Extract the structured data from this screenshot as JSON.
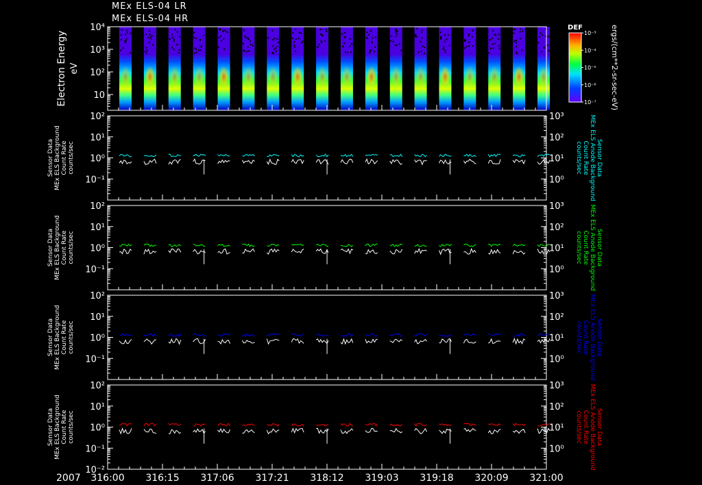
{
  "header": {
    "line1": "MEx ELS-04 LR",
    "line2": "MEx ELS-04 HR"
  },
  "time_axis": {
    "year": "2007",
    "ticks": [
      "316:00",
      "316:15",
      "317:06",
      "317:21",
      "318:12",
      "319:03",
      "319:18",
      "320:09",
      "321:00"
    ]
  },
  "colors": {
    "background": "#000000",
    "axes": "#ffffff",
    "trace_primary": "#ffffff",
    "cyan": "#00ffff",
    "green": "#00ff00",
    "blue": "#0000ff",
    "red": "#ff0000"
  },
  "chart_data": [
    {
      "type": "heatmap",
      "ylabel": "Electron Energy",
      "ylabel_unit": "eV",
      "y_scale": "log",
      "ylim": [
        2,
        10000
      ],
      "ytick_labels": [
        "10",
        "10²",
        "10³",
        "10⁴"
      ],
      "colorbar": {
        "title": "DEF",
        "label": "ergs/(cm**2-sr-sec-eV)",
        "scale": "log",
        "range": [
          1e-07,
          0.001
        ],
        "tick_labels": [
          "10⁻³",
          "10⁻⁴",
          "10⁻⁵",
          "10⁻⁶",
          "10⁻⁷"
        ]
      },
      "passes": 18
    },
    {
      "type": "line",
      "left_label": [
        "Sensor Data",
        "MEx ELS Background",
        "Count Rate",
        "counts/sec"
      ],
      "right_label": [
        "Sensor Data",
        "MEx ELS Anode Background",
        "Count Rate",
        "counts/sec"
      ],
      "right_color": "#00ffff",
      "y_scale": "log",
      "ylim_left": [
        0.01,
        100
      ],
      "ylim_right": [
        0.1,
        1000
      ],
      "left_tick_labels": [
        "10²",
        "10¹",
        "10⁰",
        "10⁻¹",
        ""
      ],
      "right_tick_labels": [
        "10³",
        "10²",
        "10¹",
        "10⁰",
        ""
      ],
      "series": [
        {
          "name": "Background",
          "color": "#ffffff",
          "typical": 0.85
        },
        {
          "name": "Anode Background",
          "color": "#00ffff",
          "typical": 13
        }
      ]
    },
    {
      "type": "line",
      "left_label": [
        "Sensor Data",
        "MEx ELS Background",
        "Count Rate",
        "counts/sec"
      ],
      "right_label": [
        "Sensor Data",
        "MEx ELS Anode Background",
        "Count Rate",
        "counts/sec"
      ],
      "right_color": "#00ff00",
      "y_scale": "log",
      "ylim_left": [
        0.01,
        100
      ],
      "ylim_right": [
        0.1,
        1000
      ],
      "left_tick_labels": [
        "10²",
        "10¹",
        "10⁰",
        "10⁻¹",
        ""
      ],
      "right_tick_labels": [
        "10³",
        "10²",
        "10¹",
        "10⁰",
        ""
      ],
      "series": [
        {
          "name": "Background",
          "color": "#ffffff",
          "typical": 0.85
        },
        {
          "name": "Anode Background",
          "color": "#00ff00",
          "typical": 13
        }
      ]
    },
    {
      "type": "line",
      "left_label": [
        "Sensor Data",
        "MEx ELS Background",
        "Count Rate",
        "counts/sec"
      ],
      "right_label": [
        "Sensor Data",
        "MEx ELS Anode Background",
        "Count Rate",
        "counts/sec"
      ],
      "right_color": "#0000ff",
      "y_scale": "log",
      "ylim_left": [
        0.01,
        100
      ],
      "ylim_right": [
        0.1,
        1000
      ],
      "left_tick_labels": [
        "10²",
        "10¹",
        "10⁰",
        "10⁻¹",
        ""
      ],
      "right_tick_labels": [
        "10³",
        "10²",
        "10¹",
        "10⁰",
        ""
      ],
      "series": [
        {
          "name": "Background",
          "color": "#ffffff",
          "typical": 0.85
        },
        {
          "name": "Anode Background",
          "color": "#0000ff",
          "typical": 13
        }
      ]
    },
    {
      "type": "line",
      "left_label": [
        "Sensor Data",
        "MEx ELS Background",
        "Count Rate",
        "counts/sec"
      ],
      "right_label": [
        "Sensor Data",
        "MEx ELS Anode Background",
        "Count Rate",
        "counts/sec"
      ],
      "right_color": "#ff0000",
      "y_scale": "log",
      "ylim_left": [
        0.01,
        100
      ],
      "ylim_right": [
        0.1,
        1000
      ],
      "left_tick_labels": [
        "10²",
        "10¹",
        "10⁰",
        "10⁻¹",
        "10⁻²"
      ],
      "right_tick_labels": [
        "10³",
        "10²",
        "10¹",
        "10⁰",
        ""
      ],
      "series": [
        {
          "name": "Background",
          "color": "#ffffff",
          "typical": 0.85
        },
        {
          "name": "Anode Background",
          "color": "#ff0000",
          "typical": 13
        }
      ]
    }
  ]
}
